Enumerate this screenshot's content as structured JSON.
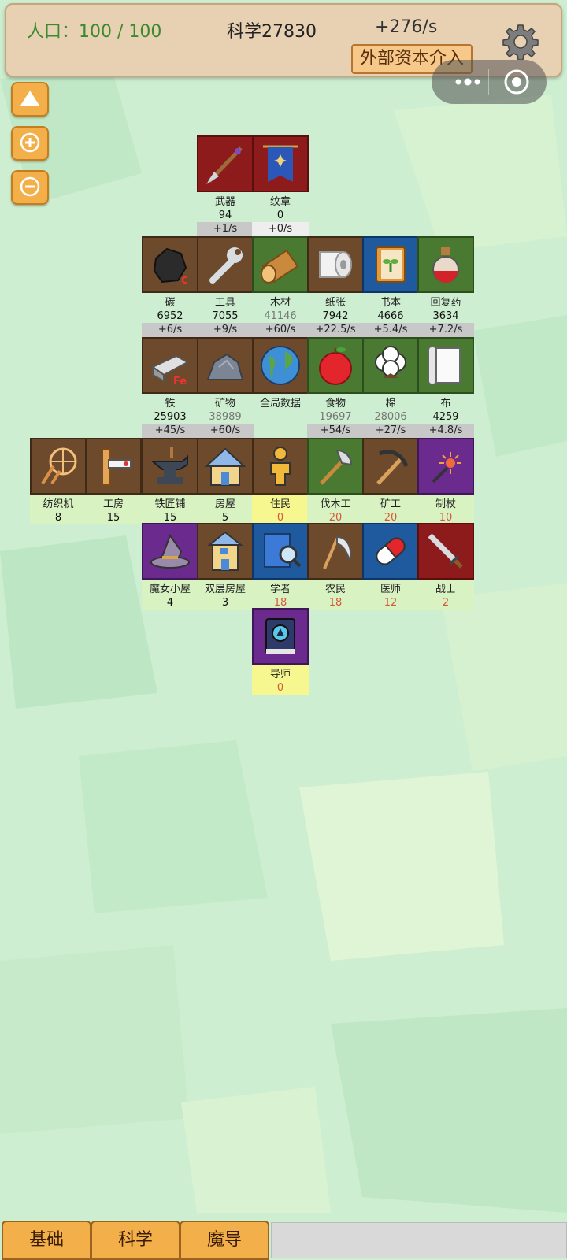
{
  "header": {
    "population": "人口：100 / 100",
    "science": "科学27830",
    "rate": "+276/s",
    "capital_button": "外部资本介入"
  },
  "tiles": {
    "weapon": {
      "label": "武器",
      "value": "94",
      "rate": "+1/s"
    },
    "emblem": {
      "label": "纹章",
      "value": "0",
      "rate": "+0/s"
    },
    "carbon": {
      "label": "碳",
      "value": "6952",
      "rate": "+6/s"
    },
    "tools": {
      "label": "工具",
      "value": "7055",
      "rate": "+9/s"
    },
    "wood": {
      "label": "木材",
      "value": "41146",
      "rate": "+60/s"
    },
    "paper": {
      "label": "纸张",
      "value": "7942",
      "rate": "+22.5/s"
    },
    "book": {
      "label": "书本",
      "value": "4666",
      "rate": "+5.4/s"
    },
    "potion": {
      "label": "回复药",
      "value": "3634",
      "rate": "+7.2/s"
    },
    "iron": {
      "label": "铁",
      "value": "25903",
      "rate": "+45/s"
    },
    "mineral": {
      "label": "矿物",
      "value": "38989",
      "rate": "+60/s"
    },
    "global": {
      "label": "全局数据"
    },
    "food": {
      "label": "食物",
      "value": "19697",
      "rate": "+54/s"
    },
    "cotton": {
      "label": "棉",
      "value": "28006",
      "rate": "+27/s"
    },
    "cloth": {
      "label": "布",
      "value": "4259",
      "rate": "+4.8/s"
    },
    "loom": {
      "label": "纺织机",
      "value": "8"
    },
    "workshop": {
      "label": "工房",
      "value": "15"
    },
    "smithy": {
      "label": "铁匠铺",
      "value": "15"
    },
    "house": {
      "label": "房屋",
      "value": "5"
    },
    "resident": {
      "label": "住民",
      "value": "0"
    },
    "lumberjack": {
      "label": "伐木工",
      "value": "20"
    },
    "miner": {
      "label": "矿工",
      "value": "20"
    },
    "wandmaker": {
      "label": "制杖",
      "value": "10"
    },
    "witchhut": {
      "label": "魔女小屋",
      "value": "4"
    },
    "duplex": {
      "label": "双层房屋",
      "value": "3"
    },
    "scholar": {
      "label": "学者",
      "value": "18"
    },
    "farmer": {
      "label": "农民",
      "value": "18"
    },
    "doctor": {
      "label": "医师",
      "value": "12"
    },
    "warrior": {
      "label": "战士",
      "value": "2"
    },
    "mentor": {
      "label": "导师",
      "value": "0"
    }
  },
  "tabs": {
    "basic": "基础",
    "science": "科学",
    "magic": "魔导"
  },
  "icons": {
    "settings": "gear-icon",
    "menu": "more-dots-icon",
    "close": "record-icon",
    "up": "triangle-up-icon",
    "zoom_in": "plus-icon",
    "zoom_out": "minus-icon"
  },
  "colors": {
    "brown": "#6e4a2c",
    "red": "#8e1b1b",
    "green": "#4a7a32",
    "blue": "#1f5a9e",
    "purple": "#6b2a8e"
  }
}
